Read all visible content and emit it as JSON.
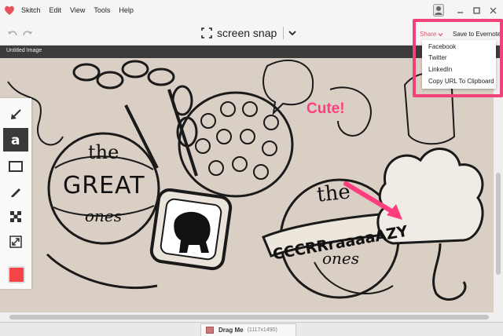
{
  "app": {
    "name": "Skitch"
  },
  "menu": [
    "Skitch",
    "Edit",
    "View",
    "Tools",
    "Help"
  ],
  "toolbar": {
    "snap_label": "screen snap",
    "share_label": "Share",
    "save_label": "Save to Evernote"
  },
  "document": {
    "title": "Untitled Image"
  },
  "share_menu": {
    "items": [
      "Facebook",
      "Twitter",
      "LinkedIn",
      "Copy URL To Clipboard"
    ]
  },
  "annotation": {
    "text": "Cute!",
    "color": "#ff3d7f"
  },
  "canvas_text": {
    "the1": "the",
    "great": "GREAT",
    "ones1": "ones",
    "the2": "the",
    "crazy": "CCCRRraaaaAZY",
    "ones2": "ones"
  },
  "tools": [
    "arrow-tool",
    "text-tool",
    "rectangle-tool",
    "pen-tool",
    "pixelate-tool",
    "crop-resize-tool"
  ],
  "colors": {
    "accent": "#f0437a",
    "current_color": "#f44447",
    "share_text": "#e05a70"
  },
  "status": {
    "drag_label": "Drag Me",
    "dimensions": "(1117x1490)"
  }
}
